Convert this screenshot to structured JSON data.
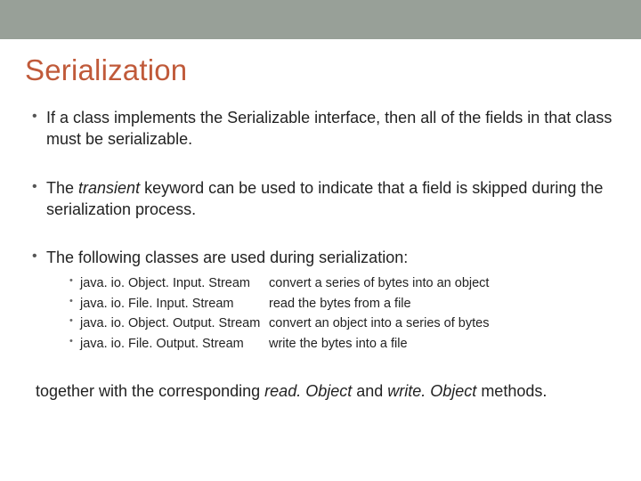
{
  "title": "Serialization",
  "bullets": {
    "b1": "If a class implements the Serializable interface, then all of the fields in that class must be serializable.",
    "b2_pre": "The ",
    "b2_kw": "transient",
    "b2_post": " keyword can be used to indicate that a field is skipped during the serialization process.",
    "b3": "The following classes are used during serialization:"
  },
  "sub": {
    "s1": {
      "cls": "java. io. Object. Input. Stream",
      "desc": "convert a series of bytes into an object"
    },
    "s2": {
      "cls": "java. io. File. Input. Stream",
      "desc": "read the bytes from a file"
    },
    "s3": {
      "cls": "java. io. Object. Output. Stream",
      "desc": "convert an object into a series of bytes"
    },
    "s4": {
      "cls": "java. io. File. Output. Stream",
      "desc": "write the bytes into a file"
    }
  },
  "trailer": {
    "pre": "  together with the corresponding ",
    "r1": "read. Object",
    "mid": " and ",
    "r2": "write. Object",
    "post": " methods."
  }
}
